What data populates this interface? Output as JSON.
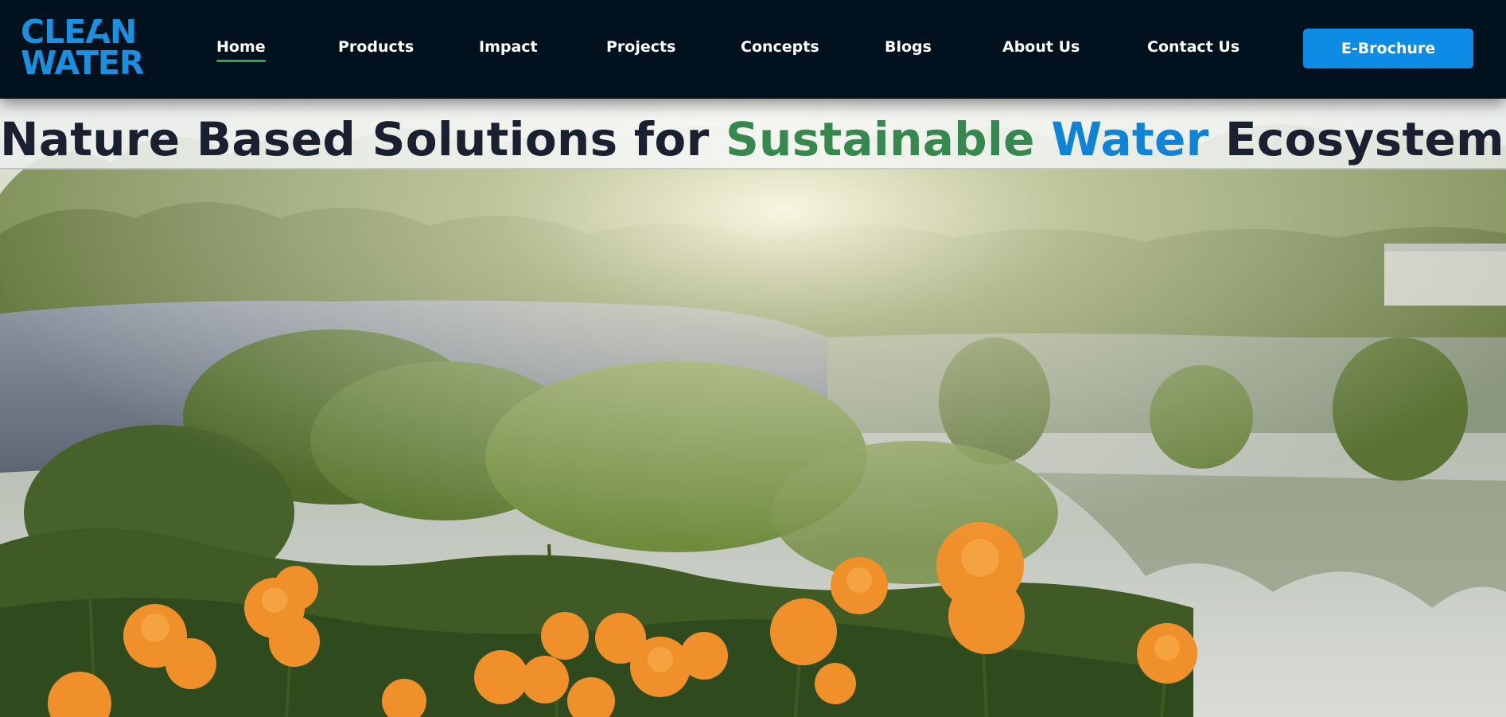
{
  "logo": {
    "line1": "CLEAN",
    "line2": "WATER"
  },
  "nav": {
    "items": [
      {
        "label": "Home",
        "active": true
      },
      {
        "label": "Products"
      },
      {
        "label": "Impact"
      },
      {
        "label": "Projects"
      },
      {
        "label": "Concepts"
      },
      {
        "label": "Blogs"
      },
      {
        "label": "About Us"
      },
      {
        "label": "Contact Us"
      }
    ],
    "cta_label": "E-Brochure"
  },
  "hero": {
    "headline": {
      "part1": "Nature Based Solutions for ",
      "highlight_green": "Sustainable",
      "space": " ",
      "highlight_blue": "Water",
      "part2": " Ecosystems"
    },
    "image_subject": "pond with reeds, shrubs and orange marigold flowers at sunrise"
  },
  "colors": {
    "header_bg": "#01111e",
    "brand_blue": "#1b8fe0",
    "cta_blue": "#0d8ce6",
    "active_underline": "#3b9a52",
    "headline_green": "#37884f",
    "headline_blue": "#0f84d6",
    "headline_dark": "#1b2030",
    "marigold": "#f0902a"
  }
}
